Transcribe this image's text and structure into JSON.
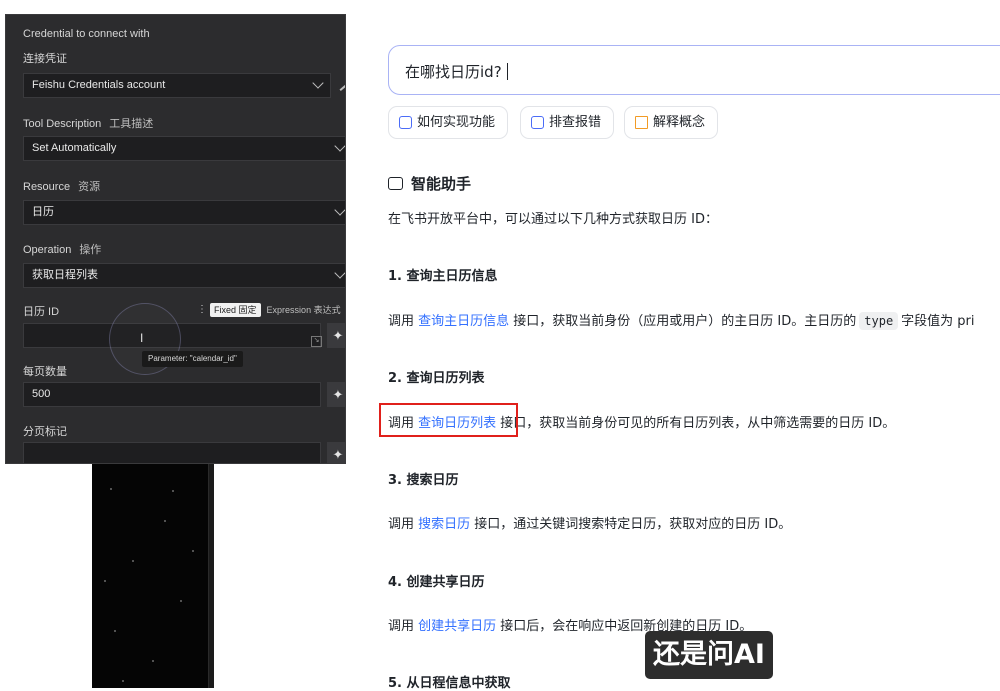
{
  "panel": {
    "credential": {
      "label": "Credential to connect with",
      "label_zh": "连接凭证",
      "value": "Feishu Credentials account"
    },
    "tool_description": {
      "label": "Tool Description",
      "label_zh": "工具描述",
      "value": "Set Automatically"
    },
    "resource": {
      "label": "Resource",
      "label_zh": "资源",
      "value": "日历"
    },
    "operation": {
      "label": "Operation",
      "label_zh": "操作",
      "value": "获取日程列表"
    },
    "calendar_id": {
      "label": "日历 ID",
      "mode_fixed": "Fixed",
      "mode_fixed_zh": "固定",
      "mode_expression": "Expression",
      "mode_expression_zh": "表达式",
      "value": "",
      "tooltip": "Parameter: \"calendar_id\""
    },
    "page_size": {
      "label": "每页数量",
      "value": "500"
    },
    "page_token": {
      "label": "分页标记",
      "value": ""
    }
  },
  "search": {
    "value": "在哪找日历id?"
  },
  "chips": [
    {
      "label": "如何实现功能",
      "icon": "search-doc-icon"
    },
    {
      "label": "排查报错",
      "icon": "chat-bug-icon"
    },
    {
      "label": "解释概念",
      "icon": "book-icon"
    }
  ],
  "answer": {
    "title": "智能助手",
    "intro": "在飞书开放平台中，可以通过以下几种方式获取日历 ID：",
    "sections": [
      {
        "heading": "1. 查询主日历信息",
        "pre": "调用 ",
        "link": "查询主日历信息",
        "post": " 接口，获取当前身份（应用或用户）的主日历 ID。主日历的",
        "code": "type",
        "post2": "字段值为 pri"
      },
      {
        "heading": "2. 查询日历列表",
        "pre": "调用 ",
        "link": "查询日历列表",
        "post": " 接口，获取当前身份可见的所有日历列表，从中筛选需要的日历 ID。"
      },
      {
        "heading": "3. 搜索日历",
        "pre": "调用 ",
        "link": "搜索日历",
        "post": " 接口，通过关键词搜索特定日历，获取对应的日历 ID。"
      },
      {
        "heading": "4. 创建共享日历",
        "pre": "调用 ",
        "link": "创建共享日历",
        "post": " 接口后，会在响应中返回新创建的日历 ID。"
      },
      {
        "heading": "5. 从日程信息中获取"
      }
    ]
  },
  "subtitle": "还是问AI",
  "colors": {
    "link": "#3370ff",
    "highlight": "#e0201b",
    "search_border": "#a9b3f5",
    "panel_bg": "#2c2c2e"
  }
}
